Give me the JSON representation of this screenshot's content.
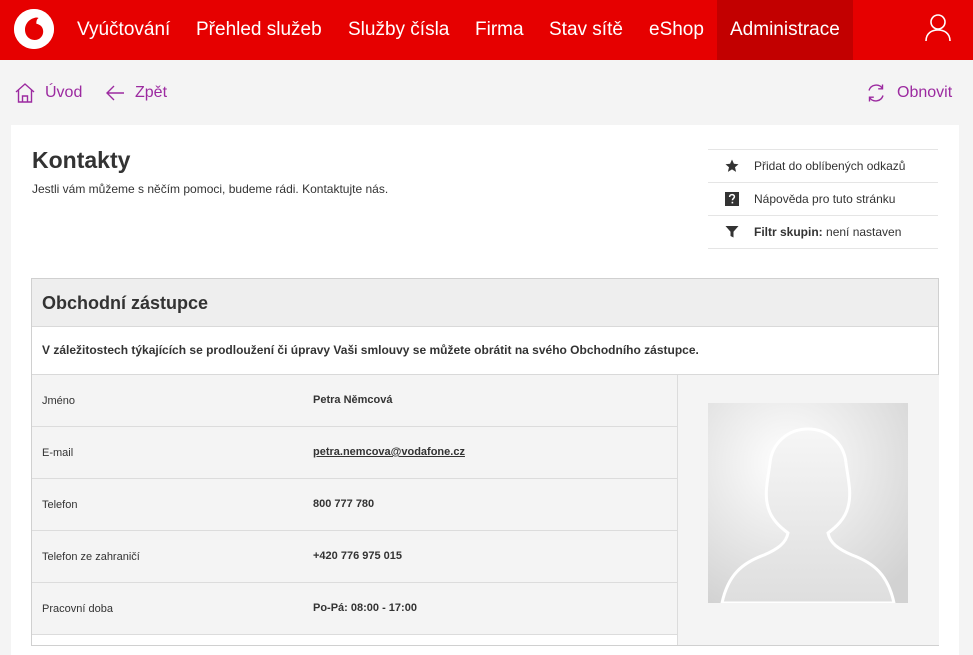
{
  "nav": {
    "items": [
      {
        "label": "Vyúčtování",
        "active": false
      },
      {
        "label": "Přehled služeb",
        "active": false
      },
      {
        "label": "Služby čísla",
        "active": false
      },
      {
        "label": "Firma",
        "active": false
      },
      {
        "label": "Stav sítě",
        "active": false
      },
      {
        "label": "eShop",
        "active": false
      },
      {
        "label": "Administrace",
        "active": true
      }
    ],
    "logo_icon": "vodafone-logo",
    "user_icon": "user-icon",
    "brand_color": "#e60000",
    "active_color": "#c20000"
  },
  "toolbar": {
    "home_label": "Úvod",
    "back_label": "Zpět",
    "refresh_label": "Obnovit",
    "link_color": "#9c2aa0"
  },
  "page": {
    "title": "Kontakty",
    "subtitle": "Jestli vám můžeme s něčím pomoci, budeme rádi. Kontaktujte nás."
  },
  "actions": {
    "favorite_label": "Přidat do oblíbených odkazů",
    "help_label": "Nápověda pro tuto stránku",
    "filter_label": "Filtr skupin:",
    "filter_value": "není nastaven"
  },
  "section": {
    "title": "Obchodní zástupce",
    "note": "V záležitostech týkajících se prodloužení či úpravy Vaši smlouvy se můžete obrátit na svého Obchodního zástupce.",
    "rows": [
      {
        "key": "Jméno",
        "value": "Petra Němcová"
      },
      {
        "key": "E-mail",
        "value": "petra.nemcova@vodafone.cz"
      },
      {
        "key": "Telefon",
        "value": "800 777 780"
      },
      {
        "key": "Telefon ze zahraničí",
        "value": "+420 776 975 015"
      },
      {
        "key": "Pracovní doba",
        "value": "Po-Pá: 08:00 - 17:00"
      }
    ]
  }
}
